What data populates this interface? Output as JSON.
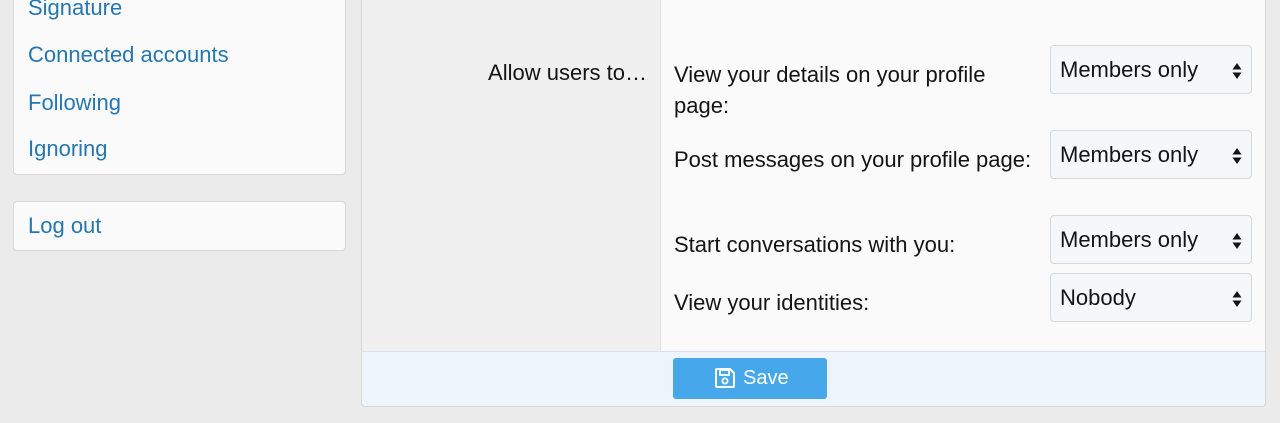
{
  "sidebar": {
    "items": [
      {
        "label": "Signature"
      },
      {
        "label": "Connected accounts"
      },
      {
        "label": "Following"
      },
      {
        "label": "Ignoring"
      }
    ],
    "logout_label": "Log out"
  },
  "form": {
    "row_label": "Allow users to…",
    "options": [
      {
        "label": "View your details on your profile page:",
        "value": "Members only",
        "icon": "select-arrows-icon"
      },
      {
        "label": "Post messages on your profile page:",
        "value": "Members only",
        "icon": "select-arrows-icon"
      },
      {
        "label": "Start conversations with you:",
        "value": "Members only",
        "icon": "select-arrows-icon"
      },
      {
        "label": "View your identities:",
        "value": "Nobody",
        "icon": "select-arrows-icon"
      }
    ],
    "save_label": "Save",
    "save_icon": "floppy-disk-icon"
  },
  "colors": {
    "link": "#2577b1",
    "button": "#47a7eb",
    "footer": "#edf4fb",
    "page_background": "#ebebeb"
  }
}
